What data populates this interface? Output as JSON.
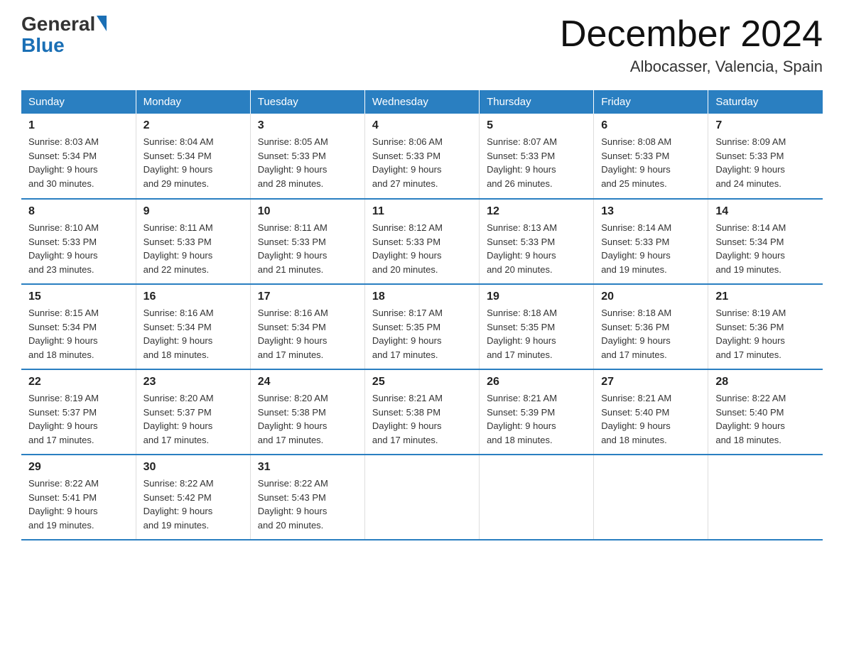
{
  "logo": {
    "general": "General",
    "blue": "Blue"
  },
  "title": "December 2024",
  "location": "Albocasser, Valencia, Spain",
  "days_of_week": [
    "Sunday",
    "Monday",
    "Tuesday",
    "Wednesday",
    "Thursday",
    "Friday",
    "Saturday"
  ],
  "weeks": [
    [
      {
        "day": "1",
        "sunrise": "8:03 AM",
        "sunset": "5:34 PM",
        "daylight": "9 hours and 30 minutes."
      },
      {
        "day": "2",
        "sunrise": "8:04 AM",
        "sunset": "5:34 PM",
        "daylight": "9 hours and 29 minutes."
      },
      {
        "day": "3",
        "sunrise": "8:05 AM",
        "sunset": "5:33 PM",
        "daylight": "9 hours and 28 minutes."
      },
      {
        "day": "4",
        "sunrise": "8:06 AM",
        "sunset": "5:33 PM",
        "daylight": "9 hours and 27 minutes."
      },
      {
        "day": "5",
        "sunrise": "8:07 AM",
        "sunset": "5:33 PM",
        "daylight": "9 hours and 26 minutes."
      },
      {
        "day": "6",
        "sunrise": "8:08 AM",
        "sunset": "5:33 PM",
        "daylight": "9 hours and 25 minutes."
      },
      {
        "day": "7",
        "sunrise": "8:09 AM",
        "sunset": "5:33 PM",
        "daylight": "9 hours and 24 minutes."
      }
    ],
    [
      {
        "day": "8",
        "sunrise": "8:10 AM",
        "sunset": "5:33 PM",
        "daylight": "9 hours and 23 minutes."
      },
      {
        "day": "9",
        "sunrise": "8:11 AM",
        "sunset": "5:33 PM",
        "daylight": "9 hours and 22 minutes."
      },
      {
        "day": "10",
        "sunrise": "8:11 AM",
        "sunset": "5:33 PM",
        "daylight": "9 hours and 21 minutes."
      },
      {
        "day": "11",
        "sunrise": "8:12 AM",
        "sunset": "5:33 PM",
        "daylight": "9 hours and 20 minutes."
      },
      {
        "day": "12",
        "sunrise": "8:13 AM",
        "sunset": "5:33 PM",
        "daylight": "9 hours and 20 minutes."
      },
      {
        "day": "13",
        "sunrise": "8:14 AM",
        "sunset": "5:33 PM",
        "daylight": "9 hours and 19 minutes."
      },
      {
        "day": "14",
        "sunrise": "8:14 AM",
        "sunset": "5:34 PM",
        "daylight": "9 hours and 19 minutes."
      }
    ],
    [
      {
        "day": "15",
        "sunrise": "8:15 AM",
        "sunset": "5:34 PM",
        "daylight": "9 hours and 18 minutes."
      },
      {
        "day": "16",
        "sunrise": "8:16 AM",
        "sunset": "5:34 PM",
        "daylight": "9 hours and 18 minutes."
      },
      {
        "day": "17",
        "sunrise": "8:16 AM",
        "sunset": "5:34 PM",
        "daylight": "9 hours and 17 minutes."
      },
      {
        "day": "18",
        "sunrise": "8:17 AM",
        "sunset": "5:35 PM",
        "daylight": "9 hours and 17 minutes."
      },
      {
        "day": "19",
        "sunrise": "8:18 AM",
        "sunset": "5:35 PM",
        "daylight": "9 hours and 17 minutes."
      },
      {
        "day": "20",
        "sunrise": "8:18 AM",
        "sunset": "5:36 PM",
        "daylight": "9 hours and 17 minutes."
      },
      {
        "day": "21",
        "sunrise": "8:19 AM",
        "sunset": "5:36 PM",
        "daylight": "9 hours and 17 minutes."
      }
    ],
    [
      {
        "day": "22",
        "sunrise": "8:19 AM",
        "sunset": "5:37 PM",
        "daylight": "9 hours and 17 minutes."
      },
      {
        "day": "23",
        "sunrise": "8:20 AM",
        "sunset": "5:37 PM",
        "daylight": "9 hours and 17 minutes."
      },
      {
        "day": "24",
        "sunrise": "8:20 AM",
        "sunset": "5:38 PM",
        "daylight": "9 hours and 17 minutes."
      },
      {
        "day": "25",
        "sunrise": "8:21 AM",
        "sunset": "5:38 PM",
        "daylight": "9 hours and 17 minutes."
      },
      {
        "day": "26",
        "sunrise": "8:21 AM",
        "sunset": "5:39 PM",
        "daylight": "9 hours and 18 minutes."
      },
      {
        "day": "27",
        "sunrise": "8:21 AM",
        "sunset": "5:40 PM",
        "daylight": "9 hours and 18 minutes."
      },
      {
        "day": "28",
        "sunrise": "8:22 AM",
        "sunset": "5:40 PM",
        "daylight": "9 hours and 18 minutes."
      }
    ],
    [
      {
        "day": "29",
        "sunrise": "8:22 AM",
        "sunset": "5:41 PM",
        "daylight": "9 hours and 19 minutes."
      },
      {
        "day": "30",
        "sunrise": "8:22 AM",
        "sunset": "5:42 PM",
        "daylight": "9 hours and 19 minutes."
      },
      {
        "day": "31",
        "sunrise": "8:22 AM",
        "sunset": "5:43 PM",
        "daylight": "9 hours and 20 minutes."
      },
      null,
      null,
      null,
      null
    ]
  ],
  "labels": {
    "sunrise": "Sunrise:",
    "sunset": "Sunset:",
    "daylight": "Daylight:"
  }
}
